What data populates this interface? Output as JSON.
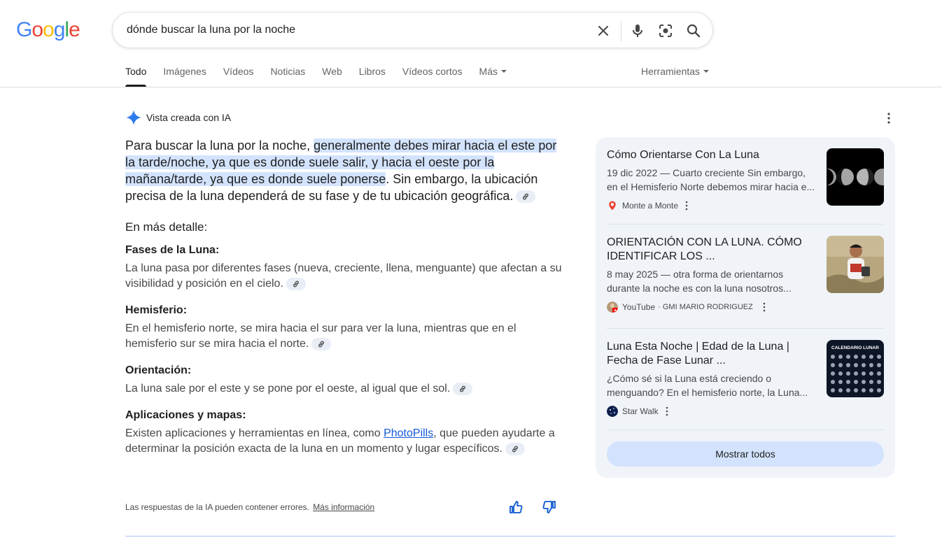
{
  "logo": {
    "text": "Google",
    "colors": [
      "#4285F4",
      "#EA4335",
      "#FBBC05",
      "#4285F4",
      "#34A853",
      "#EA4335"
    ]
  },
  "search": {
    "query": "dónde buscar la luna por la noche"
  },
  "tabs": [
    "Todo",
    "Imágenes",
    "Vídeos",
    "Noticias",
    "Web",
    "Libros",
    "Vídeos cortos",
    "Más"
  ],
  "tools_label": "Herramientas",
  "ai_overview": {
    "label": "Vista creada con IA",
    "answer_intro": "Para buscar la luna por la noche, ",
    "answer_highlight": "generalmente debes mirar hacia el este por la tarde/noche, ya que es donde suele salir, y hacia el oeste por la mañana/tarde, ya que es donde suele ponerse",
    "answer_rest": ". Sin embargo, la ubicación precisa de la luna dependerá de su fase y de tu ubicación geográfica.",
    "detail_label": "En más detalle:",
    "sections": [
      {
        "title": "Fases de la Luna:",
        "body": "La luna pasa por diferentes fases (nueva, creciente, llena, menguante) que afectan a su visibilidad y posición en el cielo."
      },
      {
        "title": "Hemisferio:",
        "body": "En el hemisferio norte, se mira hacia el sur para ver la luna, mientras que en el hemisferio sur se mira hacia el norte."
      },
      {
        "title": "Orientación:",
        "body": "La luna sale por el este y se pone por el oeste, al igual que el sol."
      },
      {
        "title": "Aplicaciones y mapas:",
        "body_before": "Existen aplicaciones y herramientas en línea, como ",
        "link": "PhotoPills",
        "body_after": ", que pueden ayudarte a determinar la posición exacta de la luna en un momento y lugar específicos."
      }
    ],
    "disclaimer": "Las respuestas de la IA pueden contener errores.",
    "more_info": "Más información"
  },
  "sources": [
    {
      "title": "Cómo Orientarse Con La Luna",
      "snippet": "19 dic 2022 — Cuarto creciente Sin embargo, en el Hemisferio Norte debemos mirar hacia e...",
      "site": "Monte a Monte",
      "sub": ""
    },
    {
      "title": "ORIENTACIÓN CON LA LUNA. CÓMO IDENTIFICAR LOS ...",
      "snippet": "8 may 2025 — otra forma de orientarnos durante la noche es con la luna nosotros...",
      "site": "YouTube",
      "sub": "· GMI MARIO RODRIGUEZ"
    },
    {
      "title": "Luna Esta Noche | Edad de la Luna | Fecha de Fase Lunar ...",
      "snippet": "¿Cómo sé si la Luna está creciendo o menguando? En el hemisferio norte, la Luna...",
      "site": "Star Walk",
      "sub": ""
    }
  ],
  "thumb3_caption": "CALENDARIO LUNAR",
  "show_all": "Mostrar todos"
}
